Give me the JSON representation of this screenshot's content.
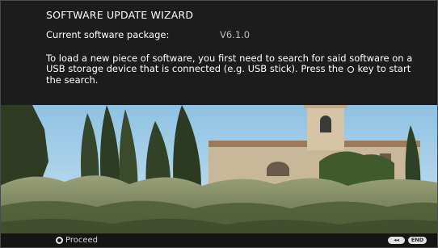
{
  "wizard": {
    "title": "SOFTWARE UPDATE WIZARD",
    "package_label": "Current software package:",
    "package_version": "V6.1.0",
    "description_part1": "To load a new piece of software, you first need to search for said software on a USB storage device that is connected (e.g. USB stick). Press the",
    "description_part2": "key to start the search.",
    "ok_key_icon": "ok-key-icon"
  },
  "footer": {
    "proceed_label": "Proceed",
    "proceed_icon": "ok-button-icon",
    "back_key_label": "◂◂",
    "end_key_label": "END"
  },
  "colors": {
    "background": "#1c1c1c",
    "text": "#ffffff",
    "version_text": "#bdbdbd",
    "key_badge": "#e2e2e2"
  },
  "photo": {
    "subject": "tuscan-landscape-photo"
  }
}
